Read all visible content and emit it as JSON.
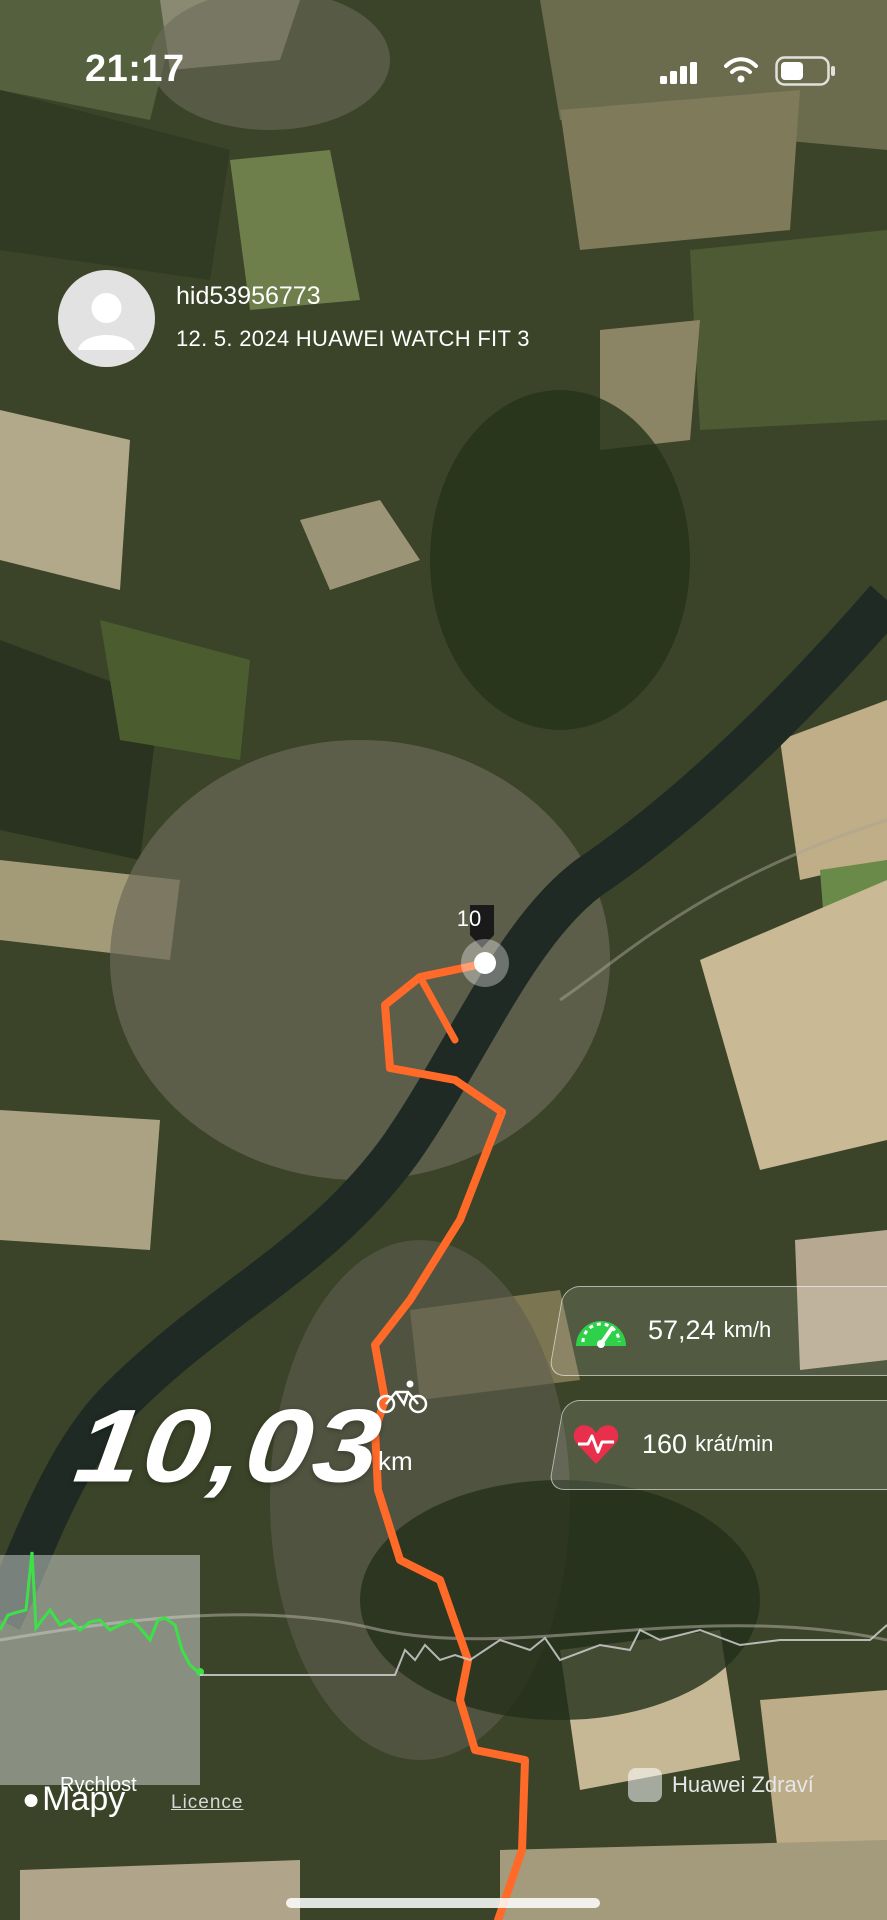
{
  "status_bar": {
    "time": "21:17",
    "signal": "signal-bars-icon",
    "wifi": "wifi-icon",
    "battery": "battery-icon"
  },
  "profile": {
    "avatar": "person-avatar-icon",
    "user_id": "hid53956773",
    "subtitle": "12. 5. 2024 HUAWEI WATCH FIT 3"
  },
  "map": {
    "waypoint_label": "10",
    "route_color": "#ff6a28"
  },
  "stats": {
    "speed_value": "57,24",
    "speed_unit": "km/h",
    "speed_icon": "speedometer-icon",
    "heart_value": "160",
    "heart_unit": "krát/min",
    "heart_icon": "heart-rate-icon"
  },
  "distance": {
    "value": "10,03",
    "unit": "km",
    "activity_icon": "cycling-icon"
  },
  "chart": {
    "label": "Rychlost",
    "accent_color": "#3ee04a"
  },
  "footer": {
    "maps_logo": "Mapy",
    "licence": "Licence",
    "brand": "Huawei Zdraví"
  }
}
